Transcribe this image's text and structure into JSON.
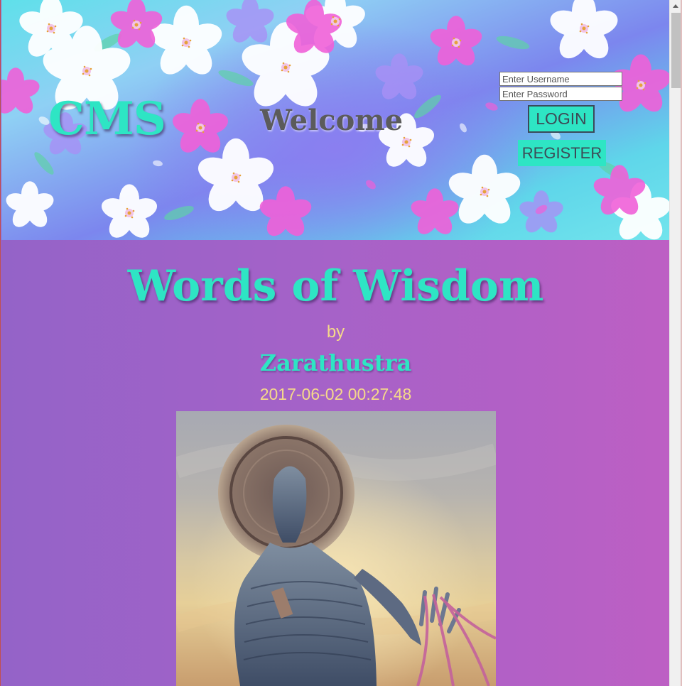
{
  "header": {
    "logo": "CMS",
    "welcome": "Welcome",
    "login_form": {
      "username_placeholder": "Enter Username",
      "password_placeholder": "Enter Password",
      "login_label": "LOGIN",
      "register_label": "REGISTER"
    }
  },
  "post": {
    "title": "Words of Wisdom",
    "by_label": "by",
    "author": "Zarathustra",
    "date": "2017-06-02 00:27:48"
  },
  "colors": {
    "accent": "#2ee5c4",
    "date_text": "#f5d98a",
    "welcome_text": "#5b5b5b",
    "main_bg_left": "#9463c8",
    "main_bg_right": "#bd5fc4"
  },
  "icons": {
    "scroll_up": "scroll-up-arrow-icon"
  }
}
